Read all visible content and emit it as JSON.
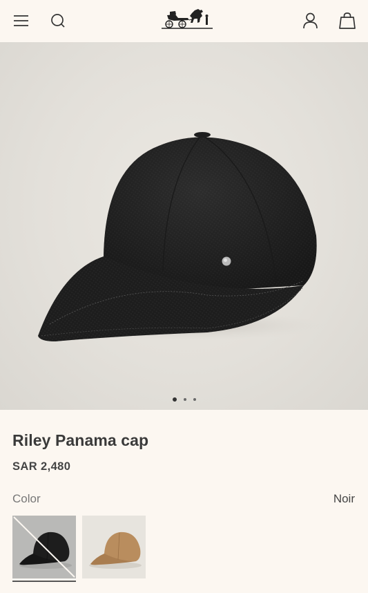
{
  "header": {
    "menu_icon": "hamburger-menu-icon",
    "search_icon": "search-icon",
    "logo": "hermes-carriage-logo",
    "account_icon": "account-icon",
    "bag_icon": "shopping-bag-icon"
  },
  "gallery": {
    "image_count": 3,
    "active_index": 0
  },
  "product": {
    "title": "Riley Panama cap",
    "price": "SAR 2,480",
    "color_label": "Color",
    "color_value": "Noir"
  },
  "swatches": [
    {
      "color": "#1f1f1f",
      "selected": true,
      "unavailable": true
    },
    {
      "color": "#b98d5e",
      "selected": false,
      "unavailable": false
    }
  ]
}
